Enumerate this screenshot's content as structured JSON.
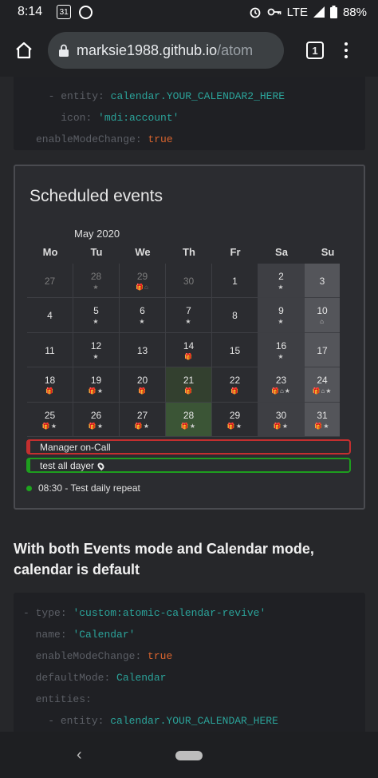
{
  "status_bar": {
    "time": "8:14",
    "calendar_icon_text": "31",
    "network": "LTE",
    "battery": "88%"
  },
  "browser": {
    "url_domain": "marksie1988.github.io",
    "url_path": "/atom",
    "tab_count": "1"
  },
  "code_block_1": {
    "lines": [
      {
        "indent": "",
        "key": "",
        "sep": "",
        "value": "",
        "value_class": ""
      },
      {
        "indent": "  - ",
        "key": "entity",
        "sep": ": ",
        "value": "calendar.YOUR_CALENDAR2_HERE",
        "value_class": "c-val"
      },
      {
        "indent": "    ",
        "key": "icon",
        "sep": ": ",
        "value": "'mdi:account'",
        "value_class": "c-str"
      },
      {
        "indent": "",
        "key": "enableModeChange",
        "sep": ": ",
        "value": "true",
        "value_class": "c-bool"
      }
    ]
  },
  "calendar_card": {
    "title": "Scheduled events",
    "month": "May 2020",
    "weekdays": [
      "Mo",
      "Tu",
      "We",
      "Th",
      "Fr",
      "Sa",
      "Su"
    ],
    "weeks": [
      [
        {
          "day": "27",
          "icons": "",
          "state": "other"
        },
        {
          "day": "28",
          "icons": "★",
          "state": "other"
        },
        {
          "day": "29",
          "icons": "🎁⌂",
          "state": "other"
        },
        {
          "day": "30",
          "icons": "",
          "state": "other"
        },
        {
          "day": "1",
          "icons": "",
          "state": ""
        },
        {
          "day": "2",
          "icons": "★",
          "state": "weekend"
        },
        {
          "day": "3",
          "icons": "",
          "state": "sunday"
        }
      ],
      [
        {
          "day": "4",
          "icons": "",
          "state": ""
        },
        {
          "day": "5",
          "icons": "★",
          "state": ""
        },
        {
          "day": "6",
          "icons": "★",
          "state": ""
        },
        {
          "day": "7",
          "icons": "★",
          "state": ""
        },
        {
          "day": "8",
          "icons": "",
          "state": ""
        },
        {
          "day": "9",
          "icons": "★",
          "state": "weekend"
        },
        {
          "day": "10",
          "icons": "⌂",
          "state": "sunday"
        }
      ],
      [
        {
          "day": "11",
          "icons": "",
          "state": ""
        },
        {
          "day": "12",
          "icons": "★",
          "state": ""
        },
        {
          "day": "13",
          "icons": "",
          "state": ""
        },
        {
          "day": "14",
          "icons": "🎁",
          "state": ""
        },
        {
          "day": "15",
          "icons": "",
          "state": ""
        },
        {
          "day": "16",
          "icons": "★",
          "state": "weekend"
        },
        {
          "day": "17",
          "icons": "",
          "state": "sunday"
        }
      ],
      [
        {
          "day": "18",
          "icons": "🎁",
          "state": ""
        },
        {
          "day": "19",
          "icons": "🎁★",
          "state": ""
        },
        {
          "day": "20",
          "icons": "🎁",
          "state": ""
        },
        {
          "day": "21",
          "icons": "🎁",
          "state": "hl"
        },
        {
          "day": "22",
          "icons": "🎁",
          "state": ""
        },
        {
          "day": "23",
          "icons": "🎁⌂★",
          "state": "weekend"
        },
        {
          "day": "24",
          "icons": "🎁⌂★",
          "state": "sunday"
        }
      ],
      [
        {
          "day": "25",
          "icons": "🎁★",
          "state": ""
        },
        {
          "day": "26",
          "icons": "🎁★",
          "state": ""
        },
        {
          "day": "27",
          "icons": "🎁★",
          "state": ""
        },
        {
          "day": "28",
          "icons": "🎁★",
          "state": "today"
        },
        {
          "day": "29",
          "icons": "🎁★",
          "state": ""
        },
        {
          "day": "30",
          "icons": "🎁★",
          "state": "weekend"
        },
        {
          "day": "31",
          "icons": "🎁★",
          "state": "sunday"
        }
      ]
    ],
    "events": {
      "manager": "Manager on-Call",
      "all_dayer": "test all dayer",
      "repeat": "08:30 - Test daily repeat"
    },
    "colors": {
      "manager_border": "#c42f2f",
      "all_dayer_border": "#1e9e1e",
      "repeat_dot": "#1ea51e"
    }
  },
  "section_heading": "With both Events mode and Calendar mode, calendar is default",
  "code_block_2": {
    "lines": [
      {
        "indent": "- ",
        "key": "type",
        "sep": ": ",
        "value": "'custom:atomic-calendar-revive'",
        "value_class": "c-str"
      },
      {
        "indent": "  ",
        "key": "name",
        "sep": ": ",
        "value": "'Calendar'",
        "value_class": "c-str"
      },
      {
        "indent": "  ",
        "key": "enableModeChange",
        "sep": ": ",
        "value": "true",
        "value_class": "c-bool"
      },
      {
        "indent": "  ",
        "key": "defaultMode",
        "sep": ": ",
        "value": "Calendar",
        "value_class": "c-val"
      },
      {
        "indent": "  ",
        "key": "entities",
        "sep": ":",
        "value": "",
        "value_class": ""
      },
      {
        "indent": "    - ",
        "key": "entity",
        "sep": ": ",
        "value": "calendar.YOUR_CALENDAR_HERE",
        "value_class": "c-val"
      }
    ]
  }
}
